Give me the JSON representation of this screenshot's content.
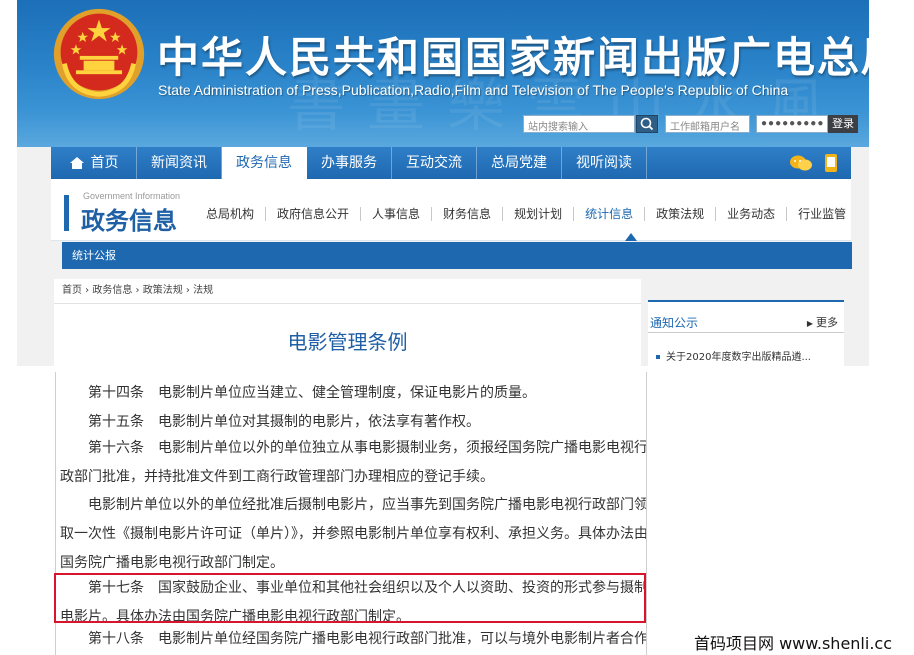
{
  "header": {
    "site_title": "中华人民共和国国家新闻出版广电总局",
    "site_subtitle": "State Administration of Press,Publication,Radio,Film and Television of The People's Republic of China",
    "search_placeholder": "站内搜索输入",
    "email_user_placeholder": "工作邮箱用户名",
    "email_password_mask": "●●●●●●●●●",
    "login_label": "登录"
  },
  "nav": {
    "items": [
      "首页",
      "新闻资讯",
      "政务信息",
      "办事服务",
      "互动交流",
      "总局党建",
      "视听阅读"
    ],
    "active": "政务信息"
  },
  "section": {
    "title_en": "Government Information",
    "title": "政务信息",
    "sub_items": [
      "总局机构",
      "政府信息公开",
      "人事信息",
      "财务信息",
      "规划计划",
      "统计信息",
      "政策法规",
      "业务动态",
      "行业监管"
    ],
    "active": "统计信息",
    "tab": "统计公报"
  },
  "breadcrumb": "首页 › 政务信息 › 政策法规 › 法规",
  "article": {
    "title": "电影管理条例",
    "paragraphs": [
      "　　第十四条　电影制片单位应当建立、健全管理制度，保证电影片的质量。",
      "　　第十五条　电影制片单位对其摄制的电影片，依法享有著作权。",
      "　　第十六条　电影制片单位以外的单位独立从事电影摄制业务，须报经国务院广播电影电视行政部门批准，并持批准文件到工商行政管理部门办理相应的登记手续。",
      "　　电影制片单位以外的单位经批准后摄制电影片，应当事先到国务院广播电影电视行政部门领取一次性《摄制电影片许可证（单片）》，并参照电影制片单位享有权利、承担义务。具体办法由国务院广播电影电视行政部门制定。",
      "　　第十七条　国家鼓励企业、事业单位和其他社会组织以及个人以资助、投资的形式参与摄制电影片。具体办法由国务院广播电影电视行政部门制定。",
      "　　第十八条　电影制片单位经国务院广播电影电视行政部门批准，可以与境外电影制片者合作摄制"
    ]
  },
  "sidebar": {
    "title": "通知公示",
    "more": "更多",
    "item": "关于2020年度数字出版精品遴..."
  },
  "watermark": "首码项目网 www.shenli.cc",
  "colors": {
    "primary": "#1e68b0",
    "highlight": "#d8152d"
  }
}
